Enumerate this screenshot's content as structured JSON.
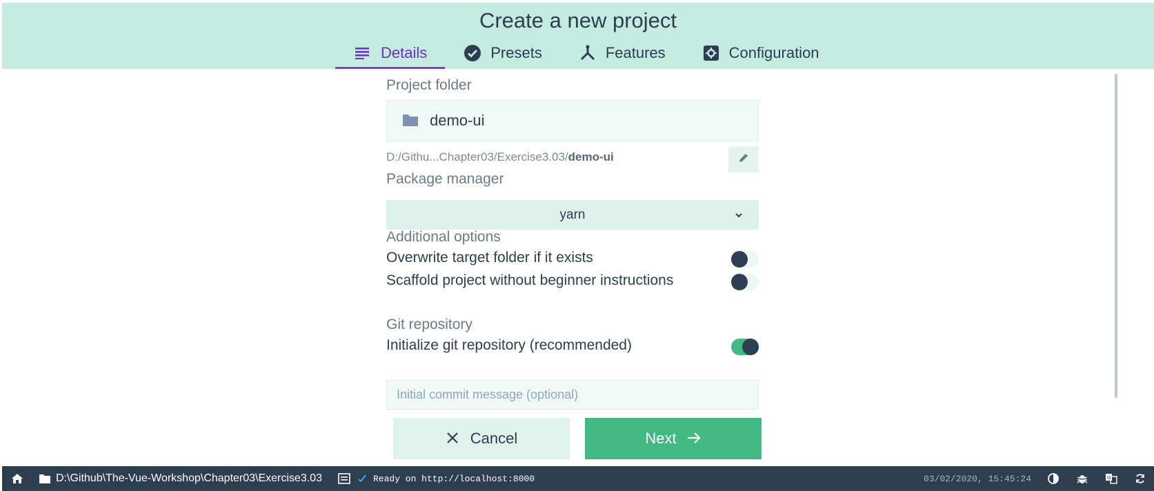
{
  "header": {
    "title": "Create a new project",
    "tabs": [
      {
        "label": "Details",
        "icon": "list-icon",
        "active": true
      },
      {
        "label": "Presets",
        "icon": "check-circle-icon",
        "active": false
      },
      {
        "label": "Features",
        "icon": "fork-icon",
        "active": false
      },
      {
        "label": "Configuration",
        "icon": "settings-icon",
        "active": false
      }
    ]
  },
  "form": {
    "project_folder_label": "Project folder",
    "project_folder_value": "demo-ui",
    "path_prefix": "D:/Githu...Chapter03/Exercise3.03/",
    "path_leaf": "demo-ui",
    "package_manager_label": "Package manager",
    "package_manager_value": "yarn",
    "additional_options_label": "Additional options",
    "options": [
      {
        "label": "Overwrite target folder if it exists",
        "enabled": false
      },
      {
        "label": "Scaffold project without beginner instructions",
        "enabled": false
      }
    ],
    "git_label": "Git repository",
    "git_init_label": "Initialize git repository (recommended)",
    "git_init_enabled": true,
    "commit_placeholder": "Initial commit message (optional)",
    "cancel_label": "Cancel",
    "next_label": "Next"
  },
  "statusbar": {
    "path": "D:\\Github\\The-Vue-Workshop\\Chapter03\\Exercise3.03",
    "status": "Ready on http://localhost:8000",
    "datetime": "03/02/2020, 15:45:24"
  },
  "colors": {
    "header_bg": "#c5eadf",
    "accent_purple": "#6a2fc9",
    "primary_green": "#42b983",
    "dark": "#2c3e50"
  }
}
